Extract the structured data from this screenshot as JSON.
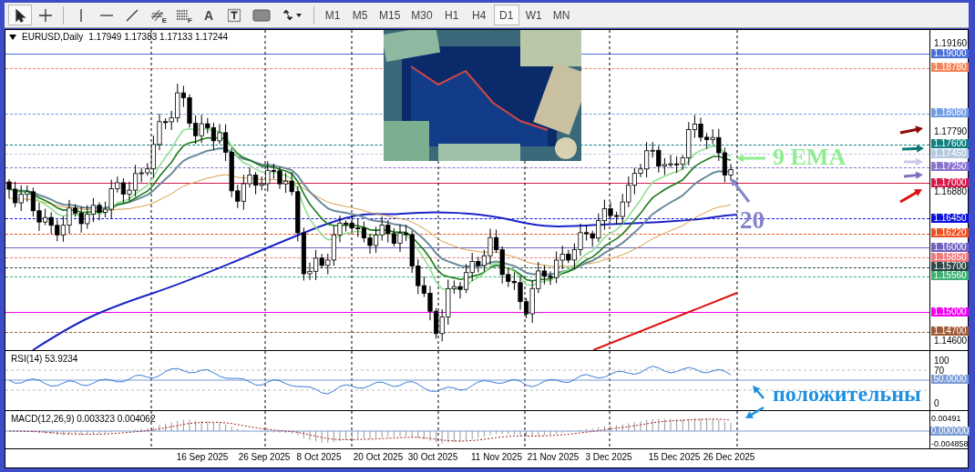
{
  "toolbar": {
    "tools": [
      {
        "kind": "cursor",
        "selected": true
      },
      {
        "kind": "crosshair",
        "selected": false
      },
      {
        "kind": "vertical_line",
        "selected": false
      },
      {
        "kind": "horizontal_line",
        "selected": false
      },
      {
        "kind": "trend_line",
        "selected": false
      },
      {
        "kind": "fibo_channel",
        "label": "E",
        "selected": false
      },
      {
        "kind": "fibo_lines",
        "label": "F",
        "selected": false
      },
      {
        "kind": "text",
        "label": "A",
        "selected": false
      },
      {
        "kind": "text_label",
        "selected": false
      },
      {
        "kind": "rectangle",
        "selected": false
      },
      {
        "kind": "shapes_menu",
        "selected": false
      }
    ],
    "timeframes": [
      {
        "label": "M1",
        "selected": false
      },
      {
        "label": "M5",
        "selected": false
      },
      {
        "label": "M15",
        "selected": false
      },
      {
        "label": "M30",
        "selected": false
      },
      {
        "label": "H1",
        "selected": false
      },
      {
        "label": "H4",
        "selected": false
      },
      {
        "label": "D1",
        "selected": true
      },
      {
        "label": "W1",
        "selected": false
      },
      {
        "label": "MN",
        "selected": false
      }
    ]
  },
  "chart": {
    "header": {
      "symbol": "EURUSD,Daily",
      "ohlc": "1.17949 1.17383 1.17133 1.17244"
    },
    "price_ticks": [
      "1.19160",
      "1.17790",
      "1.16880",
      "1.14600"
    ],
    "levels": [
      {
        "value": "1.19000",
        "color": "#4a6fd8",
        "dashed": false
      },
      {
        "value": "1.18780",
        "color": "#f5845a",
        "dashed": true
      },
      {
        "value": "1.18080",
        "color": "#6f9be6",
        "dashed": true
      },
      {
        "value": "1.17600",
        "color": "#0e8080",
        "dashed": true
      },
      {
        "value": "1.17450",
        "color": "#b4c8e0",
        "dashed": true
      },
      {
        "value": "1.17250",
        "color": "#8a72d0",
        "dashed": true
      },
      {
        "value": "1.17000",
        "color": "#d81848",
        "dashed": false
      },
      {
        "value": "1.16450",
        "color": "#0a10e0",
        "dashed": true
      },
      {
        "value": "1.16220",
        "color": "#f05020",
        "dashed": true
      },
      {
        "value": "1.16000",
        "color": "#7060c0",
        "dashed": false
      },
      {
        "value": "1.15850",
        "color": "#f07878",
        "dashed": true
      },
      {
        "value": "1.15700",
        "color": "#2c4848",
        "dashed": true
      },
      {
        "value": "1.15560",
        "color": "#3cb070",
        "dashed": true
      },
      {
        "value": "1.15000",
        "color": "#f000f0",
        "dashed": false
      },
      {
        "value": "1.14700",
        "color": "#a05a38",
        "dashed": true
      }
    ],
    "annotations": [
      {
        "text": "9 EMA",
        "color": "#90ee90"
      },
      {
        "text": "20",
        "color": "#8484c8"
      }
    ]
  },
  "rsi": {
    "label": "RSI(14) 53.9234",
    "ticks": [
      "100",
      "70",
      "0"
    ],
    "level_label": "50.0000"
  },
  "macd": {
    "label": "MACD(12,26,9) 0.003323 0.004062",
    "ticks": [
      "0.00491",
      "-0.004858"
    ],
    "zero_label": "0.000000"
  },
  "dates": [
    "16 Sep 2025",
    "26 Sep 2025",
    "8 Oct 2025",
    "20 Oct 2025",
    "30 Oct 2025",
    "11 Nov 2025",
    "21 Nov 2025",
    "3 Dec 2025",
    "15 Dec 2025",
    "26 Dec 2025"
  ],
  "note": {
    "text": "положительны",
    "color": "#1e90e0"
  }
}
